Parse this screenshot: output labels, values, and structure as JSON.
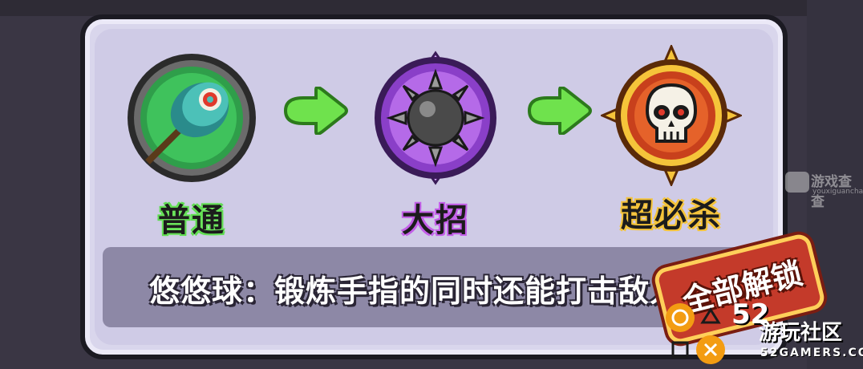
{
  "skills": [
    {
      "label": "普通",
      "icon": "yoyo-icon"
    },
    {
      "label": "大招",
      "icon": "spiked-ball-icon"
    },
    {
      "label": "超必杀",
      "icon": "skull-icon"
    }
  ],
  "description": "悠悠球：锻炼手指的同时还能打击敌人",
  "unlock_button": "全部解锁",
  "watermarks": {
    "top_right": {
      "text": "游戏查查",
      "sub": "youxiguancha.com"
    },
    "bottom_right": {
      "number": "52",
      "text": "游玩社区",
      "site": "52GAMERS.COM"
    }
  },
  "colors": {
    "normal_glow": "#58d94a",
    "ultimate_glow": "#c35fe8",
    "super_glow": "#f5c43a",
    "arrow": "#6fe24d",
    "unlock_bg": "#c43a2a"
  }
}
